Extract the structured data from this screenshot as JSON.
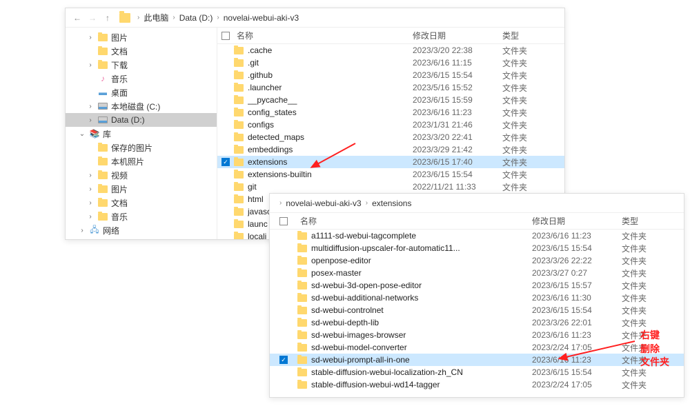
{
  "win1": {
    "breadcrumb": [
      "此电脑",
      "Data (D:)",
      "novelai-webui-aki-v3"
    ],
    "sidebar": [
      {
        "label": "图片",
        "icon": "folder",
        "level": 1,
        "chev": ">"
      },
      {
        "label": "文档",
        "icon": "folder",
        "level": 1,
        "chev": ""
      },
      {
        "label": "下载",
        "icon": "folder",
        "level": 1,
        "chev": ">"
      },
      {
        "label": "音乐",
        "icon": "music",
        "level": 1,
        "chev": ""
      },
      {
        "label": "桌面",
        "icon": "desktop",
        "level": 1,
        "chev": ""
      },
      {
        "label": "本地磁盘 (C:)",
        "icon": "disk",
        "level": 1,
        "chev": ">"
      },
      {
        "label": "Data (D:)",
        "icon": "disk",
        "level": 1,
        "chev": ">",
        "selected": true
      },
      {
        "label": "库",
        "icon": "lib",
        "level": 0,
        "chev": "v"
      },
      {
        "label": "保存的图片",
        "icon": "folder",
        "level": 1,
        "chev": ""
      },
      {
        "label": "本机照片",
        "icon": "folder",
        "level": 1,
        "chev": ""
      },
      {
        "label": "视频",
        "icon": "folder",
        "level": 1,
        "chev": ">"
      },
      {
        "label": "图片",
        "icon": "folder",
        "level": 1,
        "chev": ">"
      },
      {
        "label": "文档",
        "icon": "folder",
        "level": 1,
        "chev": ">"
      },
      {
        "label": "音乐",
        "icon": "folder",
        "level": 1,
        "chev": ">"
      },
      {
        "label": "网络",
        "icon": "net",
        "level": 0,
        "chev": ">"
      }
    ],
    "headers": {
      "name": "名称",
      "date": "修改日期",
      "type": "类型"
    },
    "files": [
      {
        "name": ".cache",
        "date": "2023/3/20 22:38",
        "type": "文件夹"
      },
      {
        "name": ".git",
        "date": "2023/6/16 11:15",
        "type": "文件夹"
      },
      {
        "name": ".github",
        "date": "2023/6/15 15:54",
        "type": "文件夹"
      },
      {
        "name": ".launcher",
        "date": "2023/5/16 15:52",
        "type": "文件夹"
      },
      {
        "name": "__pycache__",
        "date": "2023/6/15 15:59",
        "type": "文件夹"
      },
      {
        "name": "config_states",
        "date": "2023/6/16 11:23",
        "type": "文件夹"
      },
      {
        "name": "configs",
        "date": "2023/1/31 21:46",
        "type": "文件夹"
      },
      {
        "name": "detected_maps",
        "date": "2023/3/20 22:41",
        "type": "文件夹"
      },
      {
        "name": "embeddings",
        "date": "2023/3/29 21:42",
        "type": "文件夹"
      },
      {
        "name": "extensions",
        "date": "2023/6/15 17:40",
        "type": "文件夹",
        "selected": true
      },
      {
        "name": "extensions-builtin",
        "date": "2023/6/15 15:54",
        "type": "文件夹"
      },
      {
        "name": "git",
        "date": "2022/11/21 11:33",
        "type": "文件夹"
      },
      {
        "name": "html",
        "date": "",
        "type": ""
      },
      {
        "name": "javasc",
        "date": "",
        "type": ""
      },
      {
        "name": "launc",
        "date": "",
        "type": ""
      },
      {
        "name": "locali",
        "date": "",
        "type": ""
      }
    ]
  },
  "win2": {
    "breadcrumb": [
      "novelai-webui-aki-v3",
      "extensions"
    ],
    "headers": {
      "name": "名称",
      "date": "修改日期",
      "type": "类型"
    },
    "files": [
      {
        "name": "a1111-sd-webui-tagcomplete",
        "date": "2023/6/16 11:23",
        "type": "文件夹"
      },
      {
        "name": "multidiffusion-upscaler-for-automatic11...",
        "date": "2023/6/15 15:54",
        "type": "文件夹"
      },
      {
        "name": "openpose-editor",
        "date": "2023/3/26 22:22",
        "type": "文件夹"
      },
      {
        "name": "posex-master",
        "date": "2023/3/27 0:27",
        "type": "文件夹"
      },
      {
        "name": "sd-webui-3d-open-pose-editor",
        "date": "2023/6/15 15:57",
        "type": "文件夹"
      },
      {
        "name": "sd-webui-additional-networks",
        "date": "2023/6/16 11:30",
        "type": "文件夹"
      },
      {
        "name": "sd-webui-controlnet",
        "date": "2023/6/15 15:54",
        "type": "文件夹"
      },
      {
        "name": "sd-webui-depth-lib",
        "date": "2023/3/26 22:01",
        "type": "文件夹"
      },
      {
        "name": "sd-webui-images-browser",
        "date": "2023/6/16 11:23",
        "type": "文件夹"
      },
      {
        "name": "sd-webui-model-converter",
        "date": "2023/2/24 17:05",
        "type": "文件夹"
      },
      {
        "name": "sd-webui-prompt-all-in-one",
        "date": "2023/6/16 11:23",
        "type": "文件夹",
        "selected": true
      },
      {
        "name": "stable-diffusion-webui-localization-zh_CN",
        "date": "2023/6/15 15:54",
        "type": "文件夹"
      },
      {
        "name": "stable-diffusion-webui-wd14-tagger",
        "date": "2023/2/24 17:05",
        "type": "文件夹"
      }
    ]
  },
  "annotation": {
    "line1": "右键",
    "line2": "删除",
    "line3": "文件夹"
  }
}
